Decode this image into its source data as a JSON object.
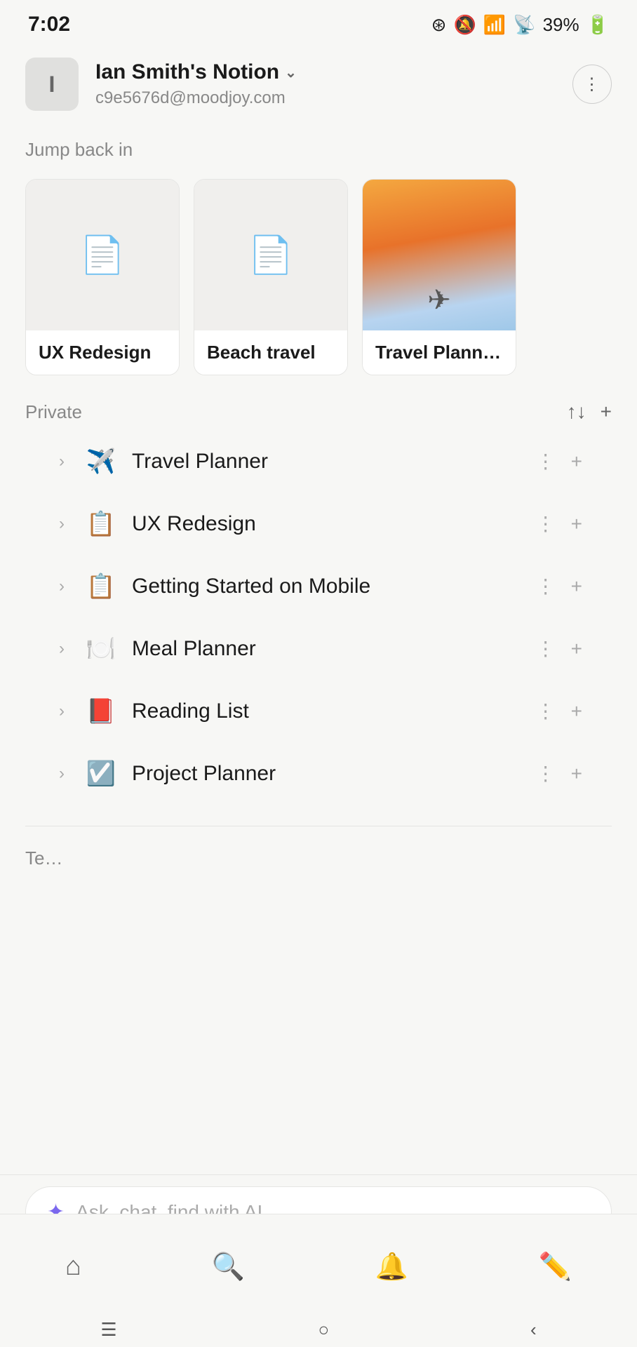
{
  "statusBar": {
    "time": "7:02",
    "batteryPercent": "39%"
  },
  "account": {
    "avatarLetter": "I",
    "name": "Ian Smith's Notion",
    "nameChevron": "⌄",
    "email": "c9e5676d@moodjoy.com",
    "moreIcon": "⋮"
  },
  "jumpBackIn": {
    "label": "Jump back in",
    "cards": [
      {
        "id": "ux-redesign",
        "label": "UX Redesign",
        "hasPhoto": false
      },
      {
        "id": "beach-travel",
        "label": "Beach travel",
        "hasPhoto": false
      },
      {
        "id": "travel-planner",
        "label": "Travel Plann…",
        "hasPhoto": true
      }
    ]
  },
  "private": {
    "label": "Private",
    "sortIcon": "↑↓",
    "addIcon": "+",
    "items": [
      {
        "id": "travel-planner",
        "icon": "✈",
        "label": "Travel Planner"
      },
      {
        "id": "ux-redesign",
        "icon": "📄",
        "label": "UX Redesign"
      },
      {
        "id": "getting-started",
        "icon": "📄",
        "label": "Getting Started on Mobile"
      },
      {
        "id": "meal-planner",
        "icon": "🍽",
        "label": "Meal Planner"
      },
      {
        "id": "reading-list",
        "icon": "📕",
        "label": "Reading List"
      },
      {
        "id": "project-planner",
        "icon": "✅",
        "label": "Project Planner"
      }
    ]
  },
  "teamspaces": {
    "label": "Te…"
  },
  "aiBar": {
    "sparkle": "✦",
    "placeholder": "Ask, chat, find with AI..."
  },
  "bottomNav": [
    {
      "id": "home",
      "icon": "⌂"
    },
    {
      "id": "search",
      "icon": "🔍"
    },
    {
      "id": "notifications",
      "icon": "🔔"
    },
    {
      "id": "edit",
      "icon": "✏"
    }
  ],
  "androidNav": [
    {
      "id": "menu",
      "icon": "☰"
    },
    {
      "id": "home-circle",
      "icon": "○"
    },
    {
      "id": "back",
      "icon": "‹"
    }
  ]
}
